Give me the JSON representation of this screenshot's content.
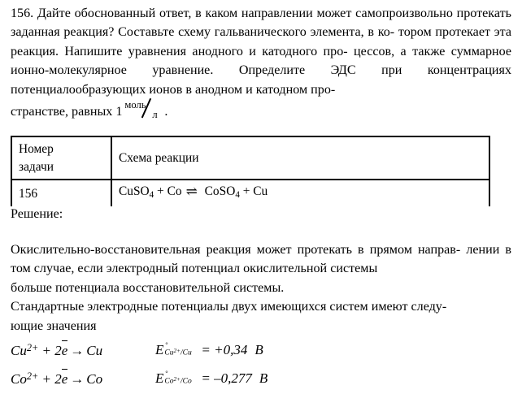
{
  "document": {
    "problem": {
      "number": "156.",
      "text_before_fraction": "156. Дайте обоснованный ответ, в каком направлении может самопроизвольно протекать заданная реакция? Составьте схему гальванического элемента, в котором протекает эта реакция. Напишите уравнения анодного и катодного процессов, а также суммарное ионно-молекулярное уравнение. Определите ЭДС при концентрациях потенциалообразующих ионов в анодном и катодном пространстве, равных 1",
      "line1": "156. Дайте обоснованный ответ, в каком направлении может самопроизвольно",
      "line2": "протекать заданная реакция? Составьте схему гальванического элемента, в ко-",
      "line3": "тором протекает эта реакция. Напишите уравнения анодного и катодного про-",
      "line4": "цессов, а также суммарное ионно-молекулярное уравнение. Определите ЭДС",
      "line5": "при концентрациях потенциалообразующих ионов в анодном и катодном про-",
      "line6_prefix": "странстве, равных 1",
      "fraction": {
        "numerator": "моль",
        "denominator": "л"
      },
      "line6_suffix": "."
    },
    "table": {
      "headers": {
        "col1_line1": "Номер",
        "col1_line2": "задачи",
        "col2": "Схема реакции"
      },
      "rows": [
        {
          "task_number": "156",
          "reaction": {
            "reactant1_formula": "CuSO",
            "reactant1_sub": "4",
            "plus1": "+",
            "reactant2": "Co",
            "arrow": "⇌",
            "product1_formula": "CoSO",
            "product1_sub": "4",
            "plus2": "+",
            "product2": "Cu",
            "full_text": "CuSO4 + Co ⇌ CoSO4 + Cu"
          }
        }
      ]
    },
    "solution": {
      "label": "Решение:",
      "paragraph1": "Окислительно-восстановительная реакция может протекать в прямом направлении в том случае, если электродный потенциал окислительной системы больше потенциала восстановительной системы.",
      "paragraph1_line1": "Окислительно-восстановительная реакция может протекать в прямом направ-",
      "paragraph1_line2": "лении в том случае, если электродный потенциал окислительной системы",
      "paragraph1_line3": "больше потенциала восстановительной системы.",
      "paragraph2": "Стандартные электродные потенциалы двух имеющихся систем имеют следующие значения",
      "paragraph2_line1": "Стандартные электродные потенциалы двух имеющихся систем имеют следу-",
      "paragraph2_line2": "ющие значения"
    },
    "equations": [
      {
        "half_reaction": {
          "species_ion": "Cu",
          "ion_charge": "2+",
          "plus": "+",
          "coefficient": "2",
          "electron": "e",
          "arrow": "→",
          "product": "Cu",
          "full_text": "Cu2+ + 2ē → Cu"
        },
        "potential": {
          "symbol": "E",
          "degree": "°",
          "subscript_species": "Cu",
          "subscript_charge": "2+",
          "subscript_slash": "/Cu",
          "equals": "=",
          "value": "+0,34",
          "unit": "В",
          "full_text": "E°Cu2+/Cu = +0,34 В"
        }
      },
      {
        "half_reaction": {
          "species_ion": "Co",
          "ion_charge": "2+",
          "plus": "+",
          "coefficient": "2",
          "electron": "e",
          "arrow": "→",
          "product": "Co",
          "full_text": "Co2+ + 2ē → Co"
        },
        "potential": {
          "symbol": "E",
          "degree": "°",
          "subscript_species": "Co",
          "subscript_charge": "2+",
          "subscript_slash": "/Co",
          "equals": "=",
          "value": "–0,277",
          "unit": "В",
          "full_text": "E°Co2+/Co = –0,277 В"
        }
      }
    ],
    "colors": {
      "text": "#000000",
      "background": "#ffffff",
      "table_border": "#000000"
    }
  }
}
